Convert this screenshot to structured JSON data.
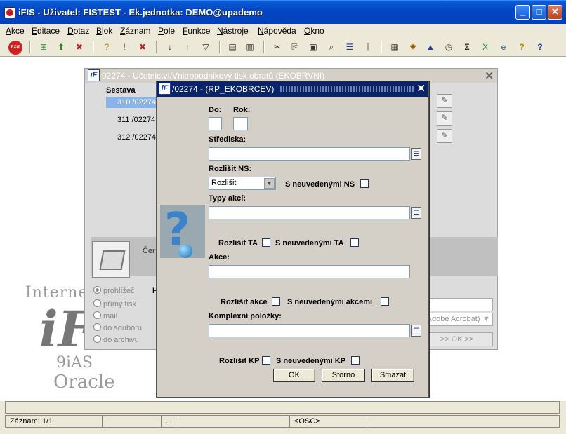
{
  "window": {
    "title": "iFIS - Uživatel: FISTEST - Ek.jednotka: DEMO@upademo"
  },
  "menu": [
    "Akce",
    "Editace",
    "Dotaz",
    "Blok",
    "Záznam",
    "Pole",
    "Funkce",
    "Nástroje",
    "Nápověda",
    "Okno"
  ],
  "toolbar": {
    "exit_label": "EXIT"
  },
  "bg_window": {
    "title": "02274 - Účetnictví/Vnitropodnikový tisk obratů (EKOBRVNI)",
    "sestava_label": "Sestava",
    "rows": [
      "310 /02274",
      "311 /02274",
      "312 /02274"
    ],
    "cer_label": "Čer",
    "radios": [
      "prohlížeč",
      "přímý tisk",
      "mail",
      "do souboru",
      "do archivu"
    ],
    "h_label": "H",
    "printer_select": "(Adobe Acrobat)",
    "ok_label": ">> OK >>"
  },
  "logo": {
    "internet": "Internet",
    "ias": "9iAS",
    "oracle": "Oracle"
  },
  "dialog": {
    "title": "/02274 - (RP_EKOBRCEV)",
    "do_label": "Do:",
    "rok_label": "Rok:",
    "strediska_label": "Střediska:",
    "rozlisit_ns_label": "Rozlišit NS:",
    "rozlisit_ns_value": "Rozlišit",
    "s_neuvedenymi_ns": "S neuvedenými NS",
    "typy_akci_label": "Typy akcí:",
    "rozlisit_ta": "Rozlišit TA",
    "s_neuvedenymi_ta": "S neuvedenými TA",
    "akce_label": "Akce:",
    "rozlisit_akce": "Rozlišit akce",
    "s_neuvedenymi_akcemi": "S neuvedenými akcemi",
    "komplexni_label": "Komplexní položky:",
    "rozlisit_kp": "Rozlišit KP",
    "s_neuvedenymi_kp": "S neuvedenými KP",
    "ok": "OK",
    "storno": "Storno",
    "smazat": "Smazat"
  },
  "status": {
    "record": "Záznam: 1/1",
    "ellipsis": "...",
    "osc": "<OSC>"
  }
}
